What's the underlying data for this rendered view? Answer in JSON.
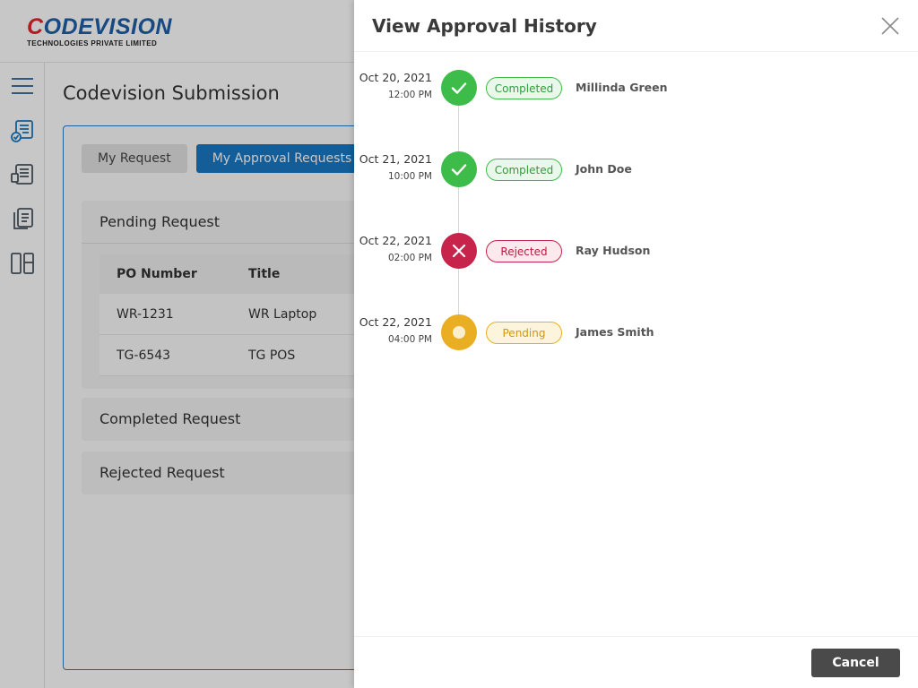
{
  "brand": {
    "logo_text": "CODEVISION",
    "logo_subtext": "TECHNOLOGIES PRIVATE LIMITED",
    "colors": {
      "primary": "#1e5fa8",
      "accent": "#e3262d"
    }
  },
  "sidebar": {
    "items": [
      {
        "icon": "menu-icon"
      },
      {
        "icon": "document-check-icon"
      },
      {
        "icon": "document-list-icon"
      },
      {
        "icon": "documents-icon"
      },
      {
        "icon": "layout-icon"
      }
    ]
  },
  "page": {
    "title": "Codevision Submission",
    "tabs": [
      {
        "label": "My Request",
        "active": false
      },
      {
        "label": "My Approval Requests",
        "active": true
      }
    ],
    "sections": {
      "pending": {
        "title": "Pending Request",
        "columns": [
          "PO Number",
          "Title"
        ],
        "rows": [
          {
            "po": "WR-1231",
            "title": "WR Laptop"
          },
          {
            "po": "TG-6543",
            "title": "TG POS"
          }
        ]
      },
      "completed": {
        "title": "Completed Request"
      },
      "rejected": {
        "title": "Rejected Request"
      }
    }
  },
  "drawer": {
    "title": "View Approval History",
    "cancel_label": "Cancel",
    "history": [
      {
        "date": "Oct 20, 2021",
        "time": "12:00 PM",
        "status": "Completed",
        "name": "Millinda Green",
        "icon": "check-icon",
        "color": "#3ebc49"
      },
      {
        "date": "Oct 21, 2021",
        "time": "10:00 PM",
        "status": "Completed",
        "name": "John Doe",
        "icon": "check-icon",
        "color": "#3ebc49"
      },
      {
        "date": "Oct 22, 2021",
        "time": "02:00 PM",
        "status": "Rejected",
        "name": "Ray Hudson",
        "icon": "cross-icon",
        "color": "#c8234a"
      },
      {
        "date": "Oct 22, 2021",
        "time": "04:00 PM",
        "status": "Pending",
        "name": "James Smith",
        "icon": "dot-icon",
        "color": "#e9ae21"
      }
    ]
  }
}
